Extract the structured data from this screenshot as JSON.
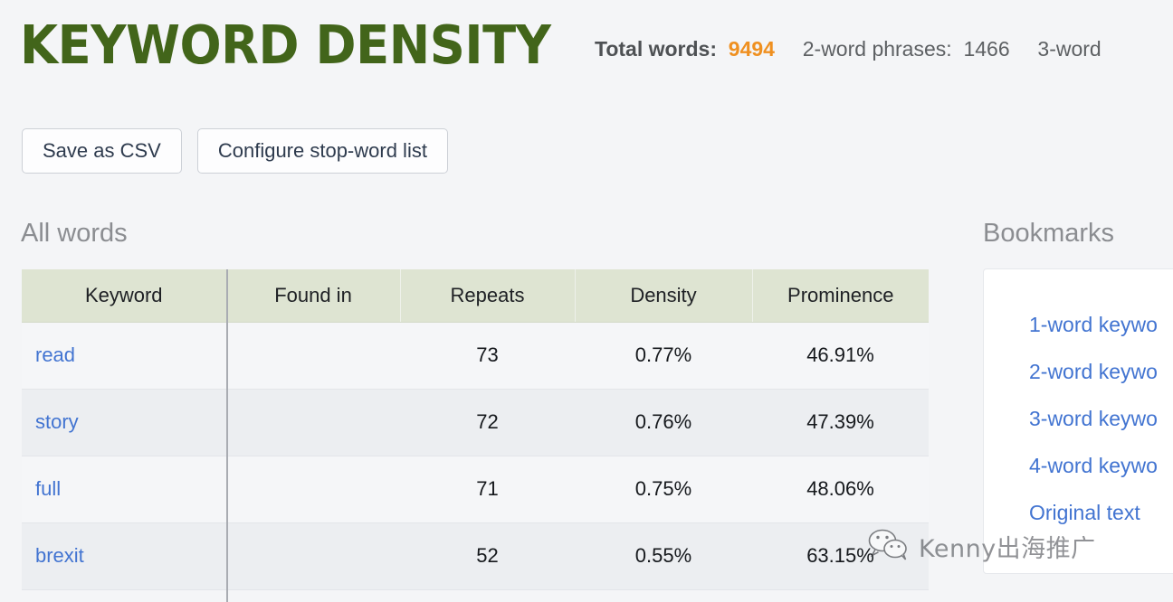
{
  "header": {
    "title": "KEYWORD DENSITY",
    "stats": {
      "total_words_label": "Total words:",
      "total_words_value": "9494",
      "two_word_label": "2-word phrases:",
      "two_word_value": "1466",
      "three_word_label_clipped": "3-word"
    }
  },
  "toolbar": {
    "save_csv_label": "Save as CSV",
    "configure_stopwords_label": "Configure stop-word list"
  },
  "sections": {
    "all_words_label": "All words",
    "bookmarks_label": "Bookmarks"
  },
  "table": {
    "columns": [
      "Keyword",
      "Found in",
      "Repeats",
      "Density",
      "Prominence"
    ],
    "rows": [
      {
        "keyword": "read",
        "found_in": "",
        "repeats": "73",
        "density": "0.77%",
        "prominence": "46.91%"
      },
      {
        "keyword": "story",
        "found_in": "",
        "repeats": "72",
        "density": "0.76%",
        "prominence": "47.39%"
      },
      {
        "keyword": "full",
        "found_in": "",
        "repeats": "71",
        "density": "0.75%",
        "prominence": "48.06%"
      },
      {
        "keyword": "brexit",
        "found_in": "",
        "repeats": "52",
        "density": "0.55%",
        "prominence": "63.15%"
      }
    ]
  },
  "bookmarks": {
    "items": [
      "1-word keywo",
      "2-word keywo",
      "3-word keywo",
      "4-word keywo",
      "Original text"
    ]
  },
  "watermark": {
    "text": "Kenny出海推广",
    "icon": "wechat-icon"
  },
  "colors": {
    "page_background": "#f4f5f7",
    "title_green": "#42651a",
    "accent_orange": "#ef9020",
    "link_blue": "#4274d1",
    "table_header_green": "#dee4d2",
    "row_odd": "#f5f6f8",
    "row_even": "#eceef1",
    "muted_label": "#8b8d91"
  }
}
